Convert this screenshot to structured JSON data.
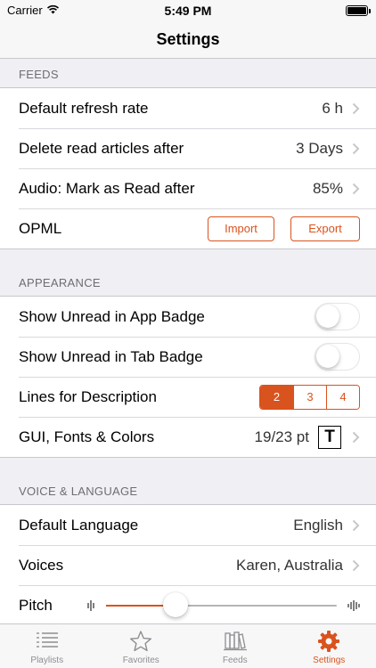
{
  "status_bar": {
    "carrier": "Carrier",
    "time": "5:49 PM"
  },
  "nav": {
    "title": "Settings"
  },
  "sections": {
    "feeds": {
      "header": "FEEDS",
      "refresh": {
        "label": "Default refresh rate",
        "value": "6 h"
      },
      "delete_read": {
        "label": "Delete read articles after",
        "value": "3 Days"
      },
      "audio_mark": {
        "label": "Audio: Mark as Read after",
        "value": "85%"
      },
      "opml": {
        "label": "OPML",
        "import_label": "Import",
        "export_label": "Export"
      }
    },
    "appearance": {
      "header": "APPEARANCE",
      "unread_app_badge": {
        "label": "Show Unread in App Badge",
        "on": false
      },
      "unread_tab_badge": {
        "label": "Show Unread in Tab Badge",
        "on": false
      },
      "lines_description": {
        "label": "Lines for Description",
        "options": [
          "2",
          "3",
          "4"
        ],
        "selected": "2"
      },
      "gui_fonts": {
        "label": "GUI, Fonts & Colors",
        "value": "19/23 pt",
        "icon_text": "T"
      }
    },
    "voice": {
      "header": "VOICE & LANGUAGE",
      "language": {
        "label": "Default Language",
        "value": "English"
      },
      "voices": {
        "label": "Voices",
        "value": "Karen, Australia"
      },
      "pitch": {
        "label": "Pitch",
        "level": 0.3
      }
    }
  },
  "tabs": [
    {
      "label": "Playlists",
      "icon": "list-icon",
      "active": false
    },
    {
      "label": "Favorites",
      "icon": "star-icon",
      "active": false
    },
    {
      "label": "Feeds",
      "icon": "books-icon",
      "active": false
    },
    {
      "label": "Settings",
      "icon": "gear-icon",
      "active": true
    }
  ],
  "colors": {
    "accent": "#d9531e",
    "secondary_text": "#8e8e93",
    "background": "#efeff4"
  }
}
